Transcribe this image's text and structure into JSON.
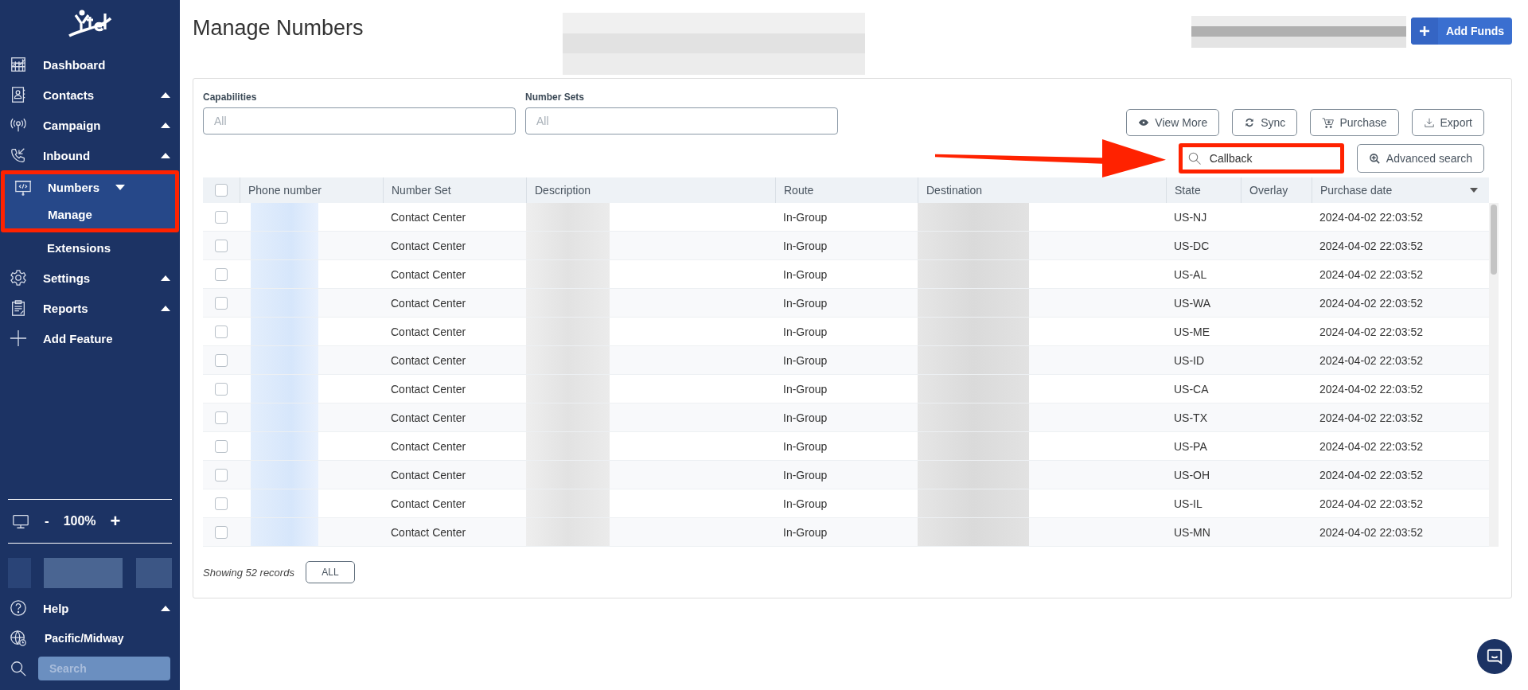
{
  "sidebar": {
    "items": [
      {
        "label": "Dashboard",
        "kind": "link"
      },
      {
        "label": "Contacts",
        "kind": "group",
        "expanded": false
      },
      {
        "label": "Campaign",
        "kind": "group",
        "expanded": false
      },
      {
        "label": "Inbound",
        "kind": "group",
        "expanded": false
      },
      {
        "label": "Numbers",
        "kind": "group",
        "expanded": true,
        "children": [
          {
            "label": "Manage",
            "selected": true
          },
          {
            "label": "Extensions",
            "selected": false
          }
        ]
      },
      {
        "label": "Settings",
        "kind": "group",
        "expanded": false
      },
      {
        "label": "Reports",
        "kind": "group",
        "expanded": false
      },
      {
        "label": "Add Feature",
        "kind": "link"
      }
    ],
    "zoom": {
      "minus": "-",
      "value": "100%",
      "plus": "+"
    },
    "help": "Help",
    "timezone": "Pacific/Midway",
    "search": {
      "placeholder": "Search"
    }
  },
  "page": {
    "title": "Manage Numbers",
    "add_funds": "Add Funds"
  },
  "filters": [
    {
      "label": "Capabilities",
      "placeholder": "All"
    },
    {
      "label": "Number Sets",
      "placeholder": "All"
    }
  ],
  "actions": [
    {
      "label": "View More"
    },
    {
      "label": "Sync"
    },
    {
      "label": "Purchase"
    },
    {
      "label": "Export"
    }
  ],
  "search": {
    "value": "Callback",
    "advanced": "Advanced search"
  },
  "table": {
    "all_checked": false,
    "columns": [
      "Phone number",
      "Number Set",
      "Description",
      "Route",
      "Destination",
      "State",
      "Overlay",
      "Purchase date"
    ],
    "rows": [
      {
        "checked": false,
        "number_set": "Contact Center",
        "route": "In-Group",
        "state": "US-NJ",
        "purchase_date": "2024-04-02 22:03:52"
      },
      {
        "checked": false,
        "number_set": "Contact Center",
        "route": "In-Group",
        "state": "US-DC",
        "purchase_date": "2024-04-02 22:03:52"
      },
      {
        "checked": false,
        "number_set": "Contact Center",
        "route": "In-Group",
        "state": "US-AL",
        "purchase_date": "2024-04-02 22:03:52"
      },
      {
        "checked": false,
        "number_set": "Contact Center",
        "route": "In-Group",
        "state": "US-WA",
        "purchase_date": "2024-04-02 22:03:52"
      },
      {
        "checked": false,
        "number_set": "Contact Center",
        "route": "In-Group",
        "state": "US-ME",
        "purchase_date": "2024-04-02 22:03:52"
      },
      {
        "checked": false,
        "number_set": "Contact Center",
        "route": "In-Group",
        "state": "US-ID",
        "purchase_date": "2024-04-02 22:03:52"
      },
      {
        "checked": false,
        "number_set": "Contact Center",
        "route": "In-Group",
        "state": "US-CA",
        "purchase_date": "2024-04-02 22:03:52"
      },
      {
        "checked": false,
        "number_set": "Contact Center",
        "route": "In-Group",
        "state": "US-TX",
        "purchase_date": "2024-04-02 22:03:52"
      },
      {
        "checked": false,
        "number_set": "Contact Center",
        "route": "In-Group",
        "state": "US-PA",
        "purchase_date": "2024-04-02 22:03:52"
      },
      {
        "checked": false,
        "number_set": "Contact Center",
        "route": "In-Group",
        "state": "US-OH",
        "purchase_date": "2024-04-02 22:03:52"
      },
      {
        "checked": false,
        "number_set": "Contact Center",
        "route": "In-Group",
        "state": "US-IL",
        "purchase_date": "2024-04-02 22:03:52"
      },
      {
        "checked": false,
        "number_set": "Contact Center",
        "route": "In-Group",
        "state": "US-MN",
        "purchase_date": "2024-04-02 22:03:52"
      }
    ]
  },
  "footer": {
    "count": "Showing 52 records",
    "all": "ALL"
  }
}
